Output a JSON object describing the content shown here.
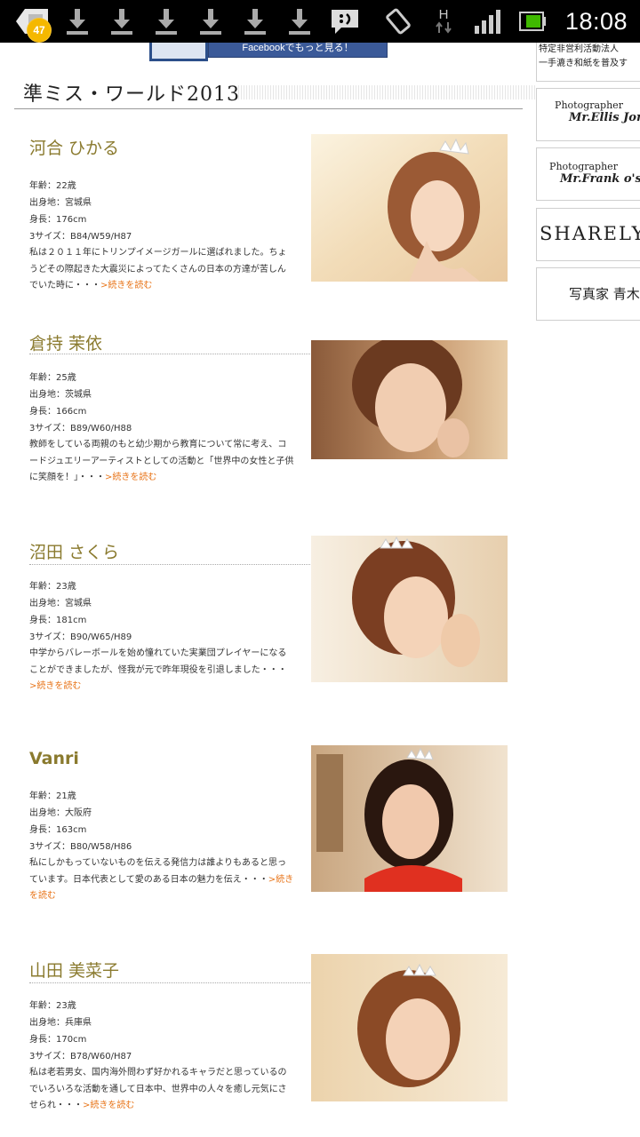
{
  "status_bar": {
    "notification_count": "47",
    "network_label": "H",
    "time": "18:08"
  },
  "header": {
    "facebook_button": "Facebookでもっと見る！"
  },
  "section": {
    "title": "準ミス・ワールド2013"
  },
  "entries": [
    {
      "name": "河合 ひかる",
      "age": "年齢：22歳",
      "hometown": "出身地：宮城県",
      "height": "身長：176cm",
      "sizes": "3サイズ：B84/W59/H87",
      "desc": "私は２０１１年にトリンプイメージガールに選ばれました。ちょうどその際起きた大震災によってたくさんの日本の方達が苦しんでいた時に・・・",
      "more": ">続きを読む"
    },
    {
      "name": "倉持 茉依",
      "age": "年齢：25歳",
      "hometown": "出身地：茨城県",
      "height": "身長：166cm",
      "sizes": "3サイズ：B89/W60/H88",
      "desc": "教師をしている両親のもと幼少期から教育について常に考え、コードジュエリーアーティストとしての活動と「世界中の女性と子供に笑顔を！」・・・",
      "more": ">続きを読む"
    },
    {
      "name": "沼田 さくら",
      "age": "年齢：23歳",
      "hometown": "出身地：宮城県",
      "height": "身長：181cm",
      "sizes": "3サイズ：B90/W65/H89",
      "desc": "中学からバレーボールを始め憧れていた実業団プレイヤーになることができましたが、怪我が元で昨年現役を引退しました・・・",
      "more": ">続きを読む"
    },
    {
      "name": "Vanri",
      "age": "年齢：21歳",
      "hometown": "出身地：大阪府",
      "height": "身長：163cm",
      "sizes": "3サイズ：B80/W58/H86",
      "desc": "私にしかもっていないものを伝える発信力は誰よりもあると思っています。日本代表として愛のある日本の魅力を伝え・・・",
      "more": ">続きを読む"
    },
    {
      "name": "山田 美菜子",
      "age": "年齢：23歳",
      "hometown": "出身地：兵庫県",
      "height": "身長：170cm",
      "sizes": "3サイズ：B78/W60/H87",
      "desc": "私は老若男女、国内海外問わず好かれるキャラだと思っているのでいろいろな活動を通して日本中、世界中の人々を癒し元気にさせられ・・・",
      "more": ">続きを読む"
    }
  ],
  "sidebar": {
    "top_line1": "特定非営利活動法人",
    "top_line2": "一手漉き和紙を普及す",
    "box1_small": "Photographer",
    "box1_big": "Mr.Ellis Jon",
    "box2_small": "Photographer",
    "box2_big": "Mr.Frank o's",
    "box3": "SHARELY",
    "box4": "写真家 青木"
  }
}
